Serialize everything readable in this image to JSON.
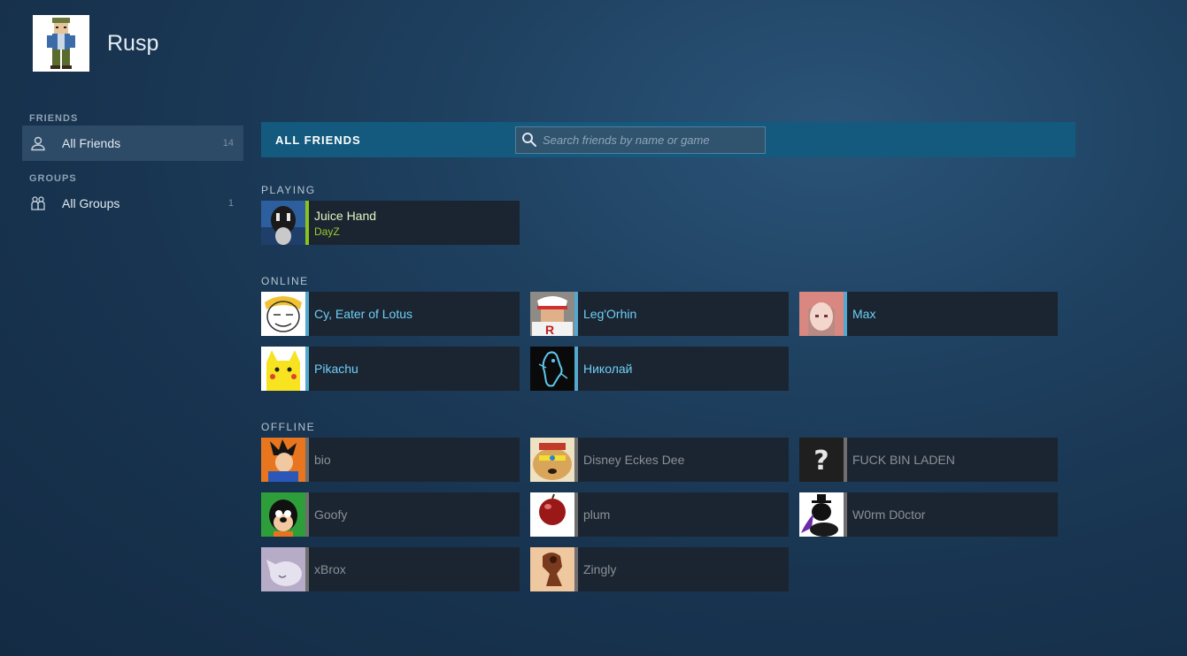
{
  "profile": {
    "name": "Rusp"
  },
  "sidebar": {
    "friends_section": "FRIENDS",
    "groups_section": "GROUPS",
    "items": [
      {
        "label": "All Friends",
        "count": "14",
        "icon": "person-icon"
      },
      {
        "label": "All Groups",
        "count": "1",
        "icon": "group-icon"
      }
    ]
  },
  "main": {
    "title": "ALL FRIENDS",
    "search": {
      "placeholder": "Search friends by name or game",
      "value": ""
    },
    "groups": {
      "playing": {
        "title": "PLAYING",
        "friends": [
          {
            "name": "Juice Hand",
            "game": "DayZ"
          }
        ]
      },
      "online": {
        "title": "ONLINE",
        "friends": [
          {
            "name": "Cy, Eater of Lotus"
          },
          {
            "name": "Leg'Orhin"
          },
          {
            "name": "Max"
          },
          {
            "name": "Pikachu"
          },
          {
            "name": "Николай"
          }
        ]
      },
      "offline": {
        "title": "OFFLINE",
        "friends": [
          {
            "name": "bio"
          },
          {
            "name": "Disney Eckes Dee"
          },
          {
            "name": "FUCK BIN LADEN"
          },
          {
            "name": "Goofy"
          },
          {
            "name": "plum"
          },
          {
            "name": "W0rm D0ctor"
          },
          {
            "name": "xBrox"
          },
          {
            "name": "Zingly"
          }
        ]
      }
    }
  },
  "colors": {
    "accent_bar": "#135a7e",
    "playing": "#8cc21e",
    "online": "#53a8cf",
    "offline": "#6f6f6f"
  }
}
